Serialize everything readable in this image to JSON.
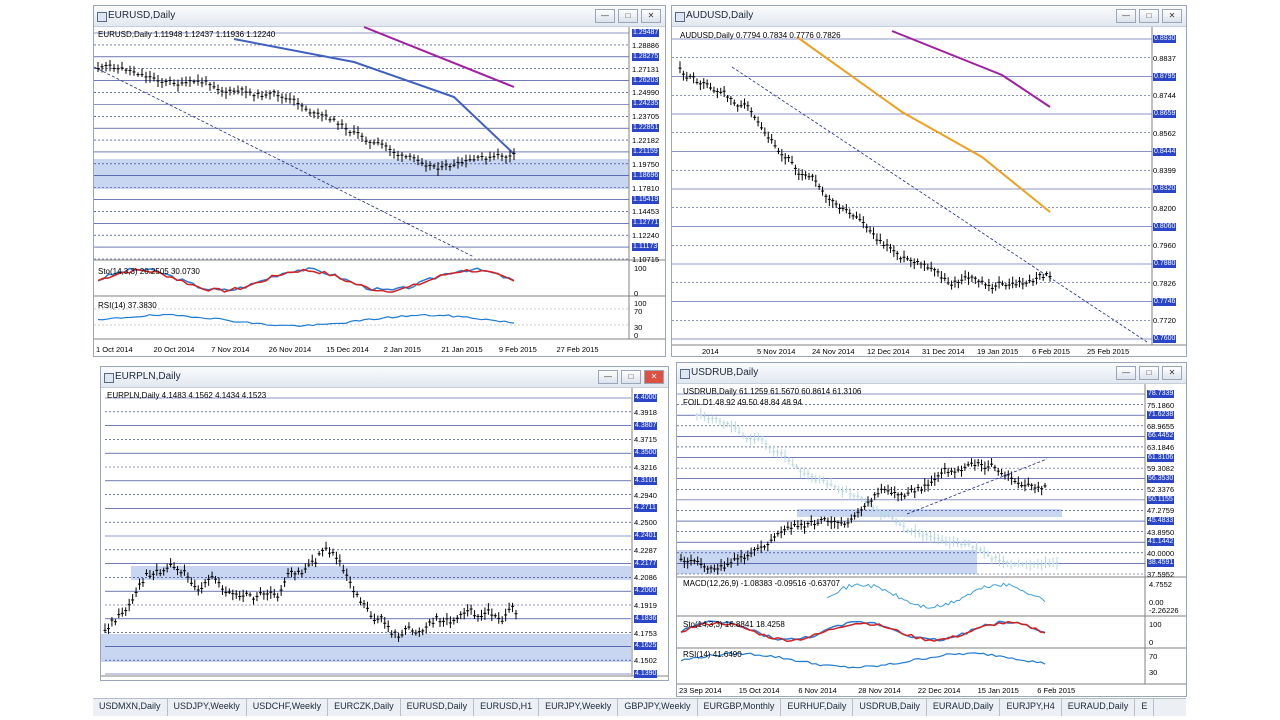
{
  "windows": {
    "eurusd": {
      "title": "EURUSD,Daily",
      "header": "EURUSD,Daily  1.11948 1.12437 1.11936 1.12240",
      "price_labels": [
        "1.29487",
        "1.28886",
        "1.28275",
        "1.27131",
        "1.26203",
        "1.24990",
        "1.24235",
        "1.23705",
        "1.22851",
        "1.22182",
        "1.21159",
        "1.19750",
        "1.18696",
        "1.17810",
        "1.15419",
        "1.14453",
        "1.12771",
        "1.12240",
        "1.11173",
        "1.10715"
      ],
      "stoch_header": "Sto(14,3,3) 20.2505 30.0730",
      "stoch_levels": [
        "100",
        "0"
      ],
      "rsi_header": "RSI(14) 37.3830",
      "rsi_levels": [
        "100",
        "70",
        "30",
        "0"
      ],
      "dates": [
        "1 Oct 2014",
        "20 Oct 2014",
        "7 Nov 2014",
        "26 Nov 2014",
        "15 Dec 2014",
        "2 Jan 2015",
        "21 Jan 2015",
        "9 Feb 2015",
        "27 Feb 2015"
      ]
    },
    "audusd": {
      "title": "AUDUSD,Daily",
      "header": "AUDUSD,Daily  0.7794 0.7834 0.7776 0.7826",
      "price_labels": [
        "0.8930",
        "0.8837",
        "0.8795",
        "0.8744",
        "0.8659",
        "0.8562",
        "0.8444",
        "0.8399",
        "0.8320",
        "0.8200",
        "0.8060",
        "0.7960",
        "0.7880",
        "0.7826",
        "0.7746",
        "0.7720",
        "0.7600"
      ],
      "dates": [
        "2014",
        "5 Nov 2014",
        "24 Nov 2014",
        "12 Dec 2014",
        "31 Dec 2014",
        "19 Jan 2015",
        "6 Feb 2015",
        "25 Feb 2015"
      ]
    },
    "eurpln": {
      "title": "EURPLN,Daily",
      "header": "EURPLN,Daily  4.1483 4.1562 4.1434 4.1523",
      "price_labels": [
        "4.4000",
        "4.3918",
        "4.3807",
        "4.3715",
        "4.3500",
        "4.3216",
        "4.3101",
        "4.2940",
        "4.2711",
        "4.2500",
        "4.2401",
        "4.2287",
        "4.2177",
        "4.2086",
        "4.2000",
        "4.1919",
        "4.1836",
        "4.1753",
        "4.1625",
        "4.1502",
        "4.1390"
      ],
      "dates": [
        "3 Oct 2014",
        "22 Oct 2014",
        "10 Nov 2014",
        "28 Nov 2014",
        "17 Dec 2014",
        "5 Jan 2015",
        "23 Jan 2015",
        "11 Feb 2015"
      ]
    },
    "usdrub": {
      "title": "USDRUB,Daily",
      "header": "USDRUB,Daily  61.1259 61.5670 60.8614 61.3106",
      "fol_header": "FOIL D1 48.92 49.50 48.84 48.94",
      "price_labels": [
        "78.7339",
        "75.1860",
        "71.6238",
        "68.9655",
        "66.4452",
        "63.1846",
        "61.3106",
        "59.3082",
        "56.3530",
        "52.3376",
        "50.1155",
        "47.2759",
        "45.4833",
        "43.8950",
        "41.1442",
        "40.0000",
        "38.4591",
        "37.5952"
      ],
      "macd_header": "MACD(12,26,9) -1.08383 -0.09516 -0.63707",
      "macd_levels": [
        "4.7552",
        "0.00",
        "-2.26226"
      ],
      "stoch_header": "Sto(14,3,3) 16.8841 18.4258",
      "stoch_levels": [
        "100",
        "0"
      ],
      "rsi_header": "RSI(14) 41.6490",
      "rsi_levels": [
        "70",
        "30"
      ],
      "dates": [
        "23 Sep 2014",
        "15 Oct 2014",
        "6 Nov 2014",
        "28 Nov 2014",
        "22 Dec 2014",
        "15 Jan 2015",
        "6 Feb 2015"
      ]
    }
  },
  "taskbar": {
    "tabs": [
      "USDMXN,Daily",
      "USDJPY,Weekly",
      "USDCHF,Weekly",
      "EURCZK,Daily",
      "EURUSD,Daily",
      "EURUSD,H1",
      "EURJPY,Weekly",
      "GBPJPY,Weekly",
      "EURGBP,Monthly",
      "EURHUF,Daily",
      "USDRUB,Daily",
      "EURAUD,Daily",
      "EURJPY,H4",
      "EURAUD,Daily",
      "E"
    ]
  },
  "colors": {
    "title_bar": "#e2e8f0",
    "price_tag": "#2a45c8",
    "stoch_red": "#d42020",
    "stoch_blue": "#2a7ad4",
    "rsi_blue": "#1e7bd4",
    "ma_purple": "#a020a0",
    "ma_orange": "#f0a020",
    "ma_blue": "#4060c0",
    "zone_blue": "#c8d6f2"
  }
}
